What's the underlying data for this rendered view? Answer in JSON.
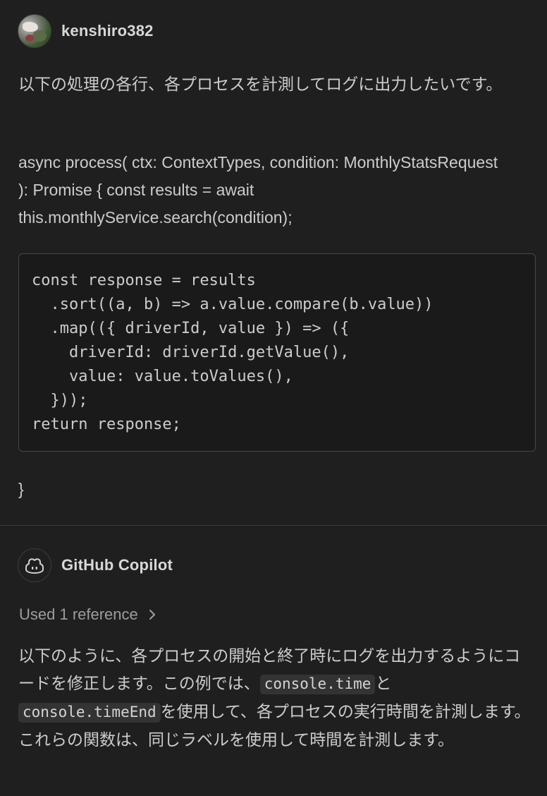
{
  "user_turn": {
    "username": "kenshiro382",
    "avatar_icon": "user-avatar-photo",
    "message_line1": "以下の処理の各行、各プロセスを計測してログに出力したいです。",
    "code_intro": "async process( ctx: ContextTypes, condition: MonthlyStatsRequest ): Promise { const results = await this.monthlyService.search(condition);",
    "code_block": "const response = results\n  .sort((a, b) => a.value.compare(b.value))\n  .map(({ driverId, value }) => ({\n    driverId: driverId.getValue(),\n    value: value.toValues(),\n  }));\nreturn response;",
    "closing_brace": "}"
  },
  "assistant_turn": {
    "name": "GitHub Copilot",
    "avatar_icon": "copilot-icon",
    "references_label": "Used 1 reference",
    "references_icon": "chevron-right-icon",
    "reply_part1": "以下のように、各プロセスの開始と終了時にログを出力するようにコードを修正します。この例では、",
    "reply_code1": "console.time",
    "reply_part2": "と",
    "reply_code2": "console.timeEnd",
    "reply_part3": "を使用して、各プロセスの実行時間を計測します。これらの関数は、同じラベルを使用して時間を計測します。"
  },
  "colors": {
    "background": "#1f1f1f",
    "text": "#cccccc",
    "muted": "#9d9d9d",
    "code_bg": "#1a1a1a",
    "inline_code_bg": "#333333",
    "border": "#474747"
  }
}
